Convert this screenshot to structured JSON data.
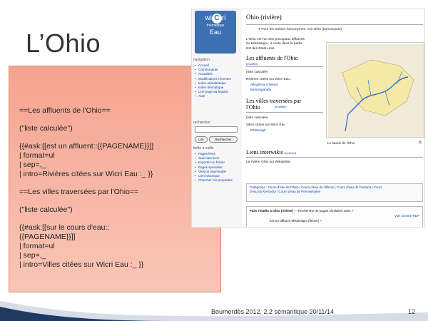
{
  "slide": {
    "title": "L’Ohio",
    "footer": "Boumerdès 2012, 2.2 sémantique    20/11/14",
    "page_number": "12"
  },
  "code": {
    "block1": [
      "==Les affluents de l'Ohio=="
    ],
    "block2": [
      "(\"liste calculée\")"
    ],
    "block3": [
      "{{#ask:[[est un affluent::{{PAGENAME}}]]",
      " | format=ul",
      " | sep=,_",
      " | intro=Rivières citées sur Wicri Eau :_ }}"
    ],
    "block4": [
      "==Les villes traversées par l'Ohio=="
    ],
    "block5": [
      "(\"liste calculée\")"
    ],
    "block6": [
      "{{#ask:[[sur le cours d'eau::",
      "{{PAGENAME}}]]",
      " | format=ul",
      " | sep=,_",
      " | intro=Villes citées sur Wicri Eau :_ }}"
    ]
  },
  "wiki": {
    "logo": {
      "wi": "wi",
      "c": "C",
      "ri": "ri",
      "sub": "thématique",
      "eau": "Eau"
    },
    "navigation_header": "navigation",
    "navigation": [
      "Accueil",
      "Communauté",
      "Actualités",
      "Modifications récentes",
      "Index alphabétique",
      "Index thématique",
      "Une page au hasard",
      "Aide"
    ],
    "search_header": "rechercher",
    "search_buttons": [
      "Lire",
      "Rechercher"
    ],
    "tools_header": "boîte à outils",
    "tools": [
      "Pages liées",
      "Suivi des liens",
      "Importer un fichier",
      "Pages spéciales",
      "Version imprimable",
      "Lien historique",
      "Chercher les propriétés"
    ],
    "page_title": "Ohio (rivière)",
    "hatnote": "Pour les articles homonymes, voir Ohio (homonymie).",
    "intro": [
      "L'Ohio est l'un des principaux affluents",
      "du Mississippi ; il coule dans la partie",
      "Est des États-Unis."
    ],
    "sec1": "Les affluents de l'Ohio",
    "edit": "[modifier]",
    "liste1": "(liste calculée)",
    "rivers_intro": "Rivières citées sur Wicri Eau :",
    "rivers": [
      "Allegheny (rivière)",
      "Monongahela"
    ],
    "sec2": [
      "Les villes traversées par",
      "l'Ohio"
    ],
    "liste2": "(liste calculée)",
    "cities_intro": "Villes citées sur Wicri Eau :",
    "cities": [
      "Pittsburgh"
    ],
    "sec3": "Liens interwikis",
    "interwiki": "La rivière Ohio sur Wikipédia.",
    "map_caption": "Le bassin de l'Ohio",
    "categories": [
      "Catégories : Cours d'eau de l'Ohio | Cours d'eau de l'Illinois | Cours d'eau de l'Indiana | Cours",
      "d'eau du Kentucky | Cours d'eau de Pennsylvanie"
    ],
    "facts_title": "Faits relatifs à Ohio (rivière)",
    "facts_search": "— Recherche de pages similaires avec +",
    "facts_rdf": "Voir comme RDF",
    "facts_row": "Est un affluent   Mississippi (fleuve) +"
  }
}
